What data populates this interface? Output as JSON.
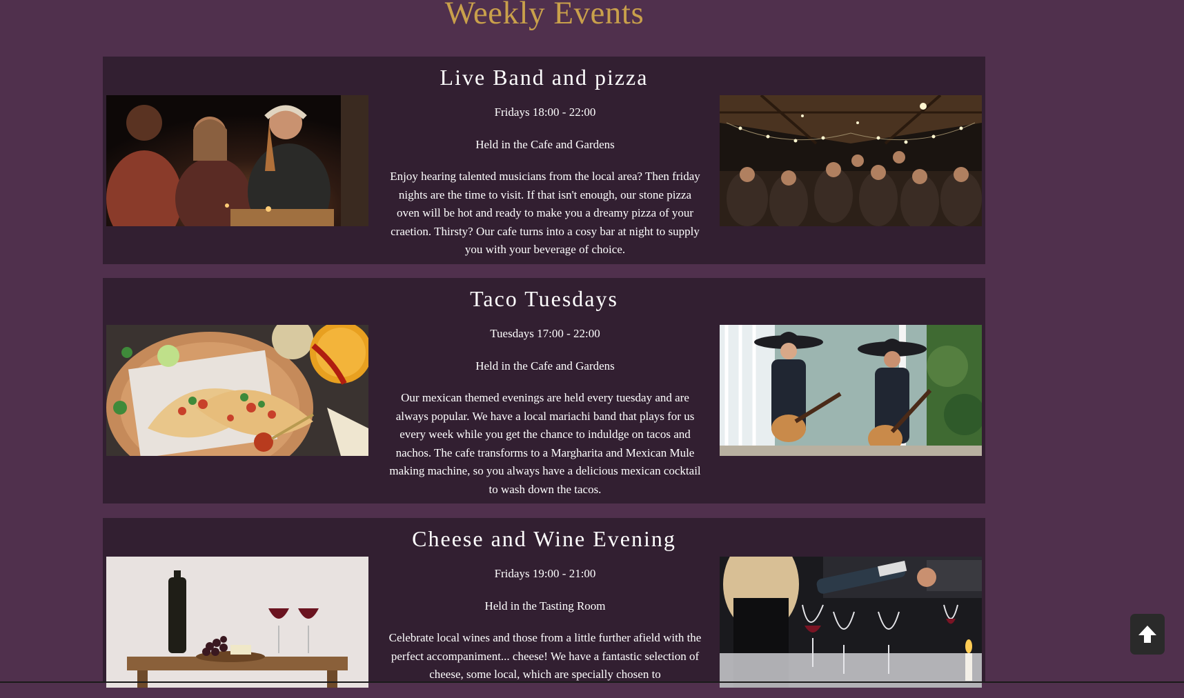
{
  "page": {
    "title": "Weekly Events"
  },
  "events": [
    {
      "title": "Live Band and pizza",
      "time": "Fridays 18:00 - 22:00",
      "location": "Held in the Cafe and Gardens",
      "description": "Enjoy hearing talented musicians from the local area? Then friday nights are the time to visit. If that isn't enough, our stone pizza oven will be hot and ready to make you a dreamy pizza of your craetion. Thirsty? Our cafe turns into a cosy bar at night to supply you with your beverage of choice."
    },
    {
      "title": "Taco Tuesdays",
      "time": "Tuesdays 17:00 - 22:00",
      "location": "Held in the Cafe and Gardens",
      "description": "Our mexican themed evenings are held every tuesday and are always popular. We have a local mariachi band that plays for us every week while you get the chance to induldge on tacos and nachos. The cafe transforms to a Margharita and Mexican Mule making machine, so you always have a delicious mexican cocktail to wash down the tacos."
    },
    {
      "title": "Cheese and Wine Evening",
      "time": "Fridays 19:00 - 21:00",
      "location": "Held in the Tasting Room",
      "description": "Celebrate local wines and those from a little further afield with the perfect accompaniment... cheese! We have a fantastic selection of cheese, some local, which are specially chosen to"
    }
  ],
  "icons": {
    "scroll_top": "arrow-up-icon"
  },
  "colors": {
    "background": "#50304d",
    "card": "#321f31",
    "title": "#c9a04b",
    "text": "#ffffff"
  }
}
